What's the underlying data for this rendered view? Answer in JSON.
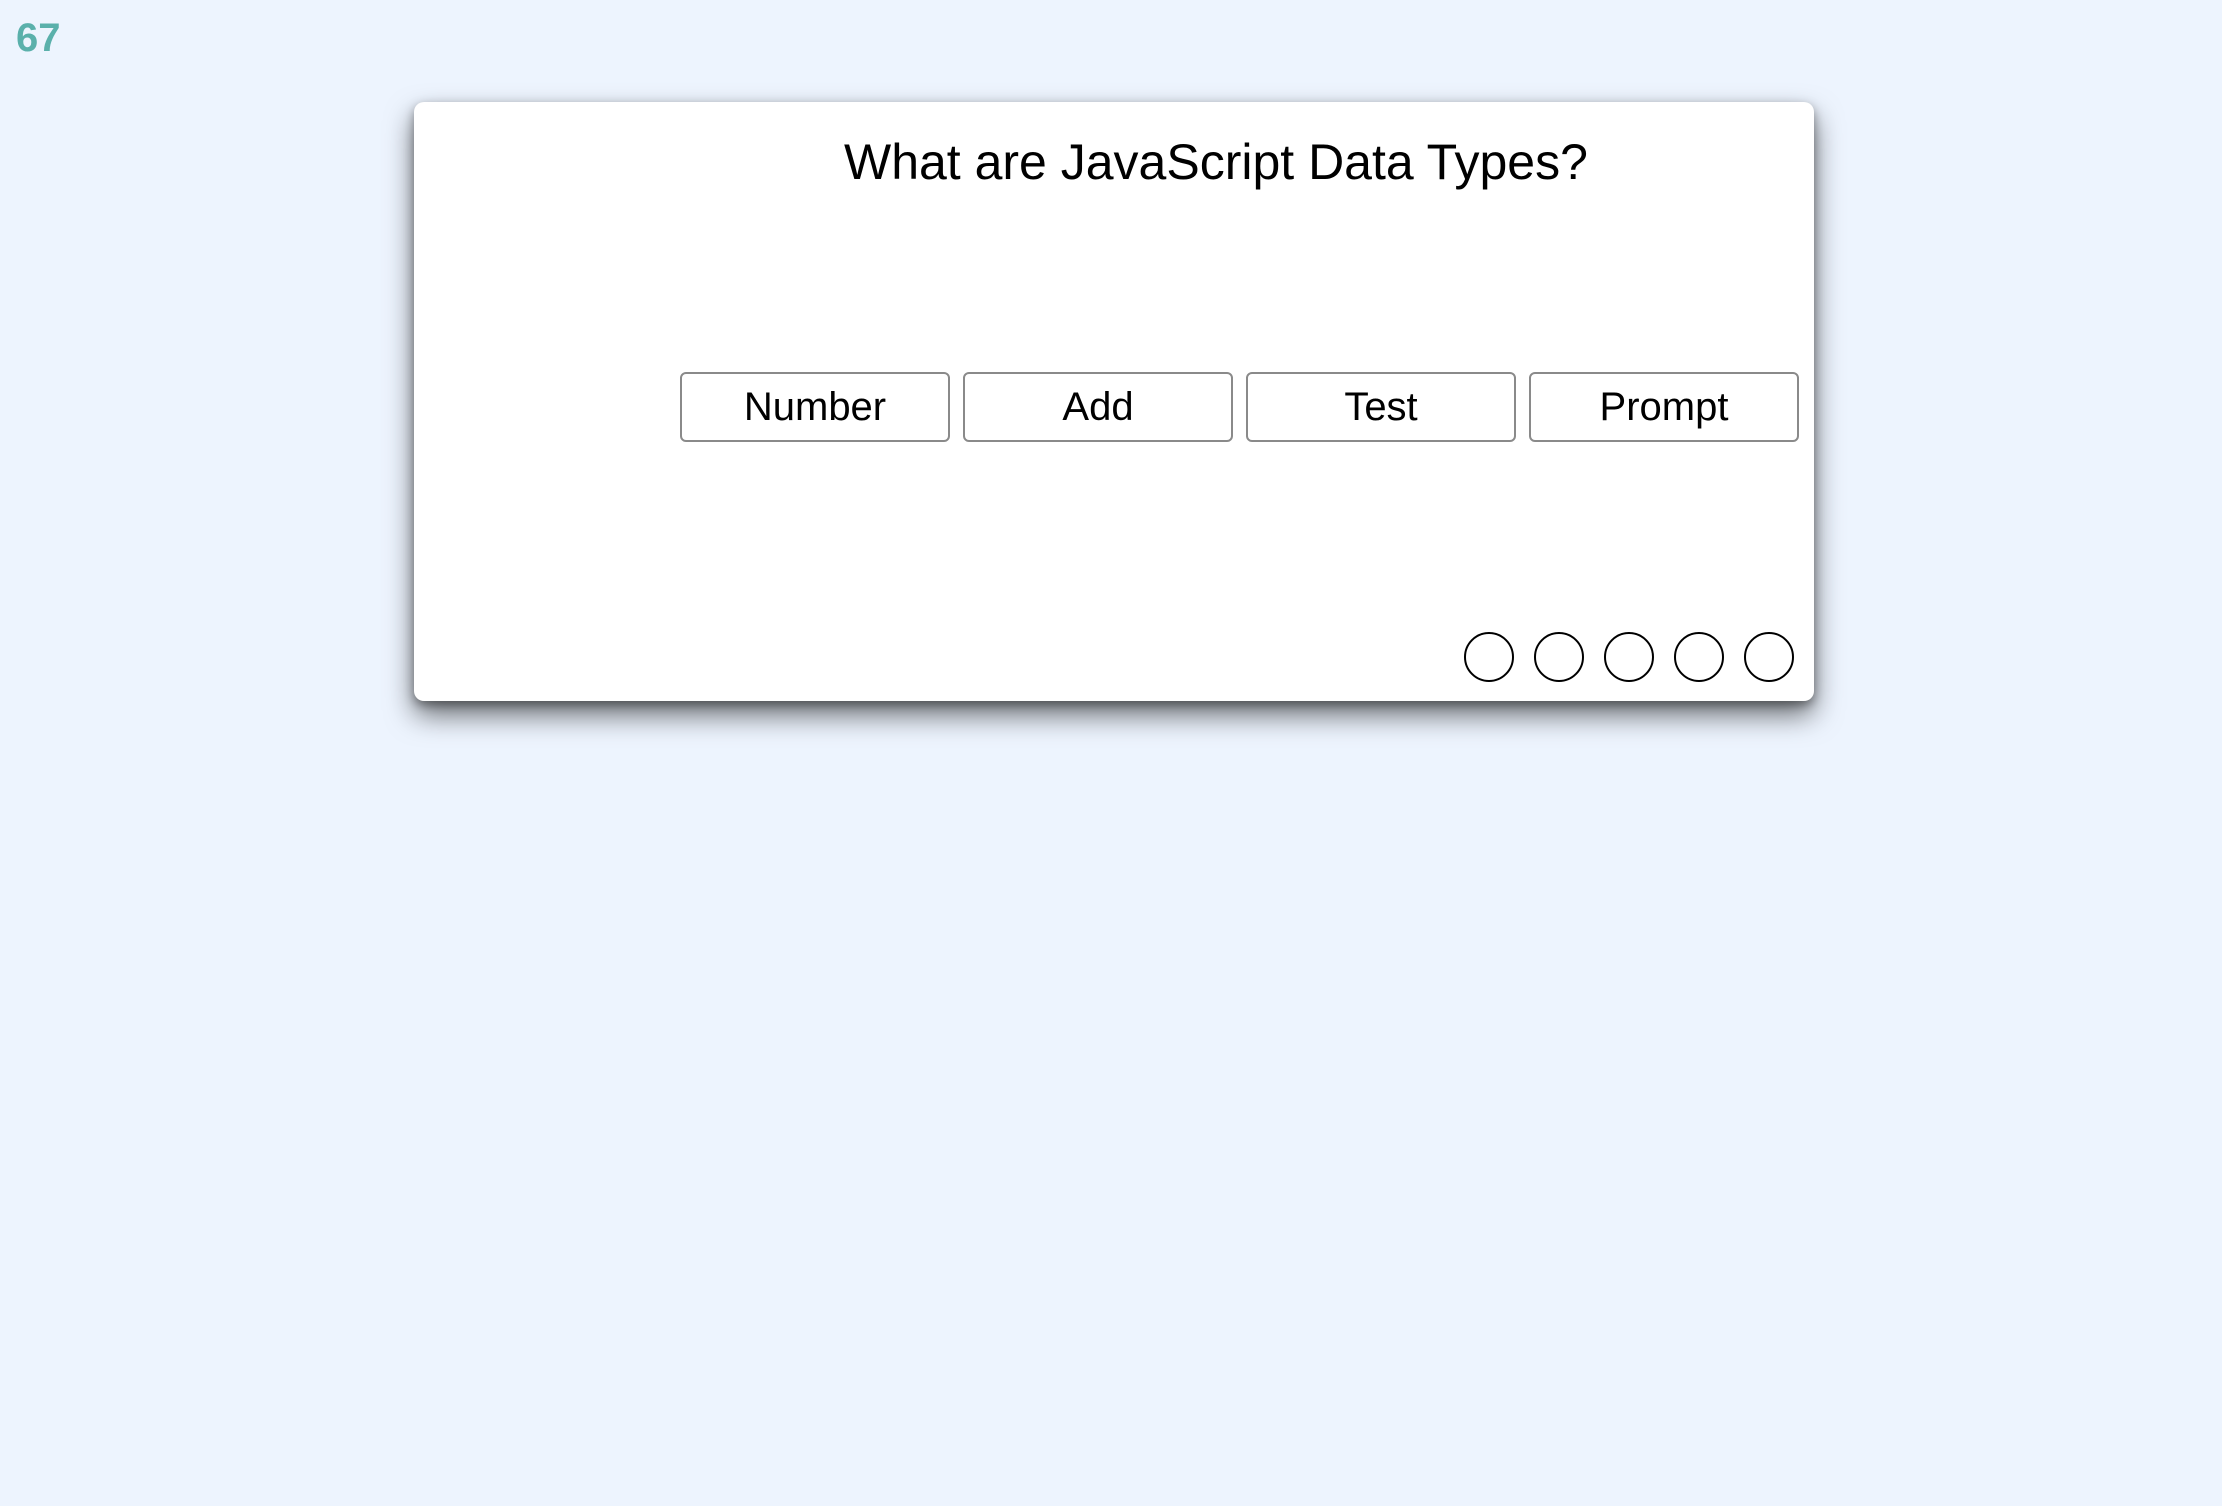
{
  "timer": {
    "value": "67"
  },
  "quiz": {
    "question": "What are JavaScript Data Types?",
    "answers": [
      {
        "label": "Number"
      },
      {
        "label": "Add"
      },
      {
        "label": "Test"
      },
      {
        "label": "Prompt"
      }
    ],
    "progress": {
      "total": 5,
      "completed": 0
    }
  },
  "colors": {
    "background": "#edf4fe",
    "timer": "#5ab0ab",
    "card": "#ffffff"
  }
}
